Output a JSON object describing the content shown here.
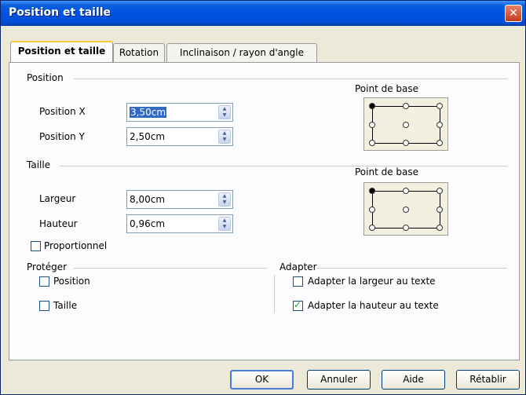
{
  "window": {
    "title": "Position et taille",
    "close_symbol": "✕"
  },
  "tabs": [
    {
      "label": "Position et taille",
      "active": true
    },
    {
      "label": "Rotation",
      "active": false
    },
    {
      "label": "Inclinaison / rayon d'angle",
      "active": false
    }
  ],
  "position_section": {
    "header": "Position",
    "x_label": "Position X",
    "x_value": "3,50cm",
    "y_label": "Position Y",
    "y_value": "2,50cm",
    "base_label": "Point de base",
    "base_selected": "top-left"
  },
  "size_section": {
    "header": "Taille",
    "width_label": "Largeur",
    "width_value": "8,00cm",
    "height_label": "Hauteur",
    "height_value": "0,96cm",
    "base_label": "Point de base",
    "base_selected": "top-left",
    "proportional_label": "Proportionnel",
    "proportional_checked": false
  },
  "protect_section": {
    "header": "Protéger",
    "position_label": "Position",
    "position_checked": false,
    "size_label": "Taille",
    "size_checked": false
  },
  "adapt_section": {
    "header": "Adapter",
    "fit_width_label": "Adapter la largeur au texte",
    "fit_width_checked": false,
    "fit_height_label": "Adapter la hauteur au texte",
    "fit_height_checked": true
  },
  "buttons": {
    "ok": "OK",
    "cancel": "Annuler",
    "help": "Aide",
    "reset": "Rétablir"
  },
  "colors": {
    "titlebar": "#0054e3",
    "selection": "#316ac5",
    "dialog_bg": "#ece9d8"
  }
}
